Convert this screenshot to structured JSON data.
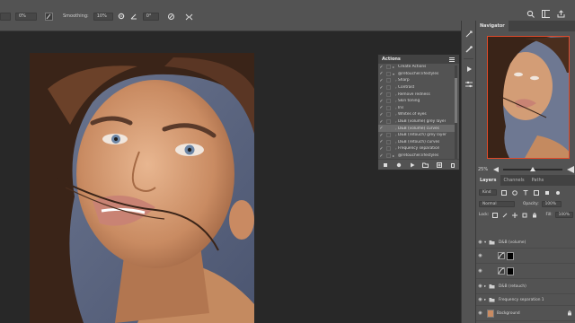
{
  "options_bar": {
    "percent_value": "0%",
    "smoothing_label": "Smoothing:",
    "smoothing_value": "10%",
    "angle_value": "0°"
  },
  "actions_panel": {
    "title": "Actions",
    "items": [
      {
        "label": "Create Actions",
        "checked": true,
        "kind": "folder"
      },
      {
        "label": "@retoucher.lifestyles",
        "checked": true,
        "kind": "folder"
      },
      {
        "label": "Sharp",
        "checked": true,
        "kind": "action"
      },
      {
        "label": "Contrast",
        "checked": true,
        "kind": "action"
      },
      {
        "label": "Remove redness",
        "checked": true,
        "kind": "action"
      },
      {
        "label": "Skin toning",
        "checked": true,
        "kind": "action"
      },
      {
        "label": "Iris",
        "checked": true,
        "kind": "action"
      },
      {
        "label": "Whites of eyes",
        "checked": true,
        "kind": "action"
      },
      {
        "label": "D&B (volume) grey layer",
        "checked": true,
        "kind": "action"
      },
      {
        "label": "D&B (volume) curves",
        "checked": true,
        "kind": "action",
        "selected": true
      },
      {
        "label": "D&B (retouch) grey layer",
        "checked": true,
        "kind": "action"
      },
      {
        "label": "D&B (retouch) curves",
        "checked": true,
        "kind": "action"
      },
      {
        "label": "Frequency separation",
        "checked": true,
        "kind": "action"
      },
      {
        "label": "@retoucher.lifestyles",
        "checked": true,
        "kind": "folder"
      }
    ]
  },
  "navigator": {
    "tab_label": "Navigator",
    "zoom_label": "25%"
  },
  "layers_panel": {
    "tabs": [
      "Layers",
      "Channels",
      "Paths"
    ],
    "kind_label": "Kind",
    "blend_mode": "Normal",
    "opacity_label": "Opacity:",
    "opacity_value": "100%",
    "lock_label": "Lock:",
    "fill_label": "Fill:",
    "fill_value": "100%",
    "layers": [
      {
        "name": "D&B (volume)",
        "type": "group"
      },
      {
        "name": "",
        "type": "curves-mask"
      },
      {
        "name": "",
        "type": "curves-mask"
      },
      {
        "name": "D&B (retouch)",
        "type": "group"
      },
      {
        "name": "Frequency separation 1",
        "type": "group"
      },
      {
        "name": "Background",
        "type": "image",
        "locked": true
      }
    ]
  }
}
